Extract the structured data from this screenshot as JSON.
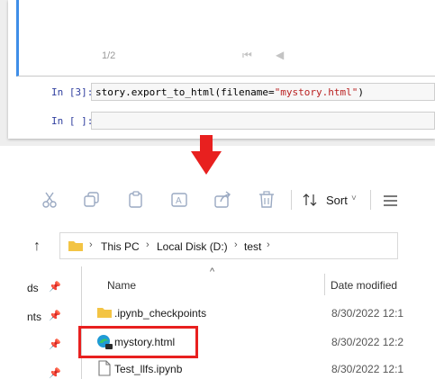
{
  "notebook": {
    "slide_counter": "1/2",
    "first_button": "⏮",
    "prev_button": "◀",
    "cells": [
      {
        "prompt": "In [3]:",
        "code_plain": "story.export_to_html(filename=",
        "code_string": "\"mystory.html\"",
        "code_end": ")"
      },
      {
        "prompt": "In [ ]:",
        "code_plain": "",
        "code_string": "",
        "code_end": ""
      }
    ]
  },
  "arrow": {
    "color": "#e8201f",
    "direction": "down"
  },
  "explorer": {
    "toolbar": {
      "icons": [
        "cut-icon",
        "copy-icon",
        "paste-icon",
        "rename-icon",
        "share-icon",
        "delete-icon"
      ],
      "sort_label": "Sort",
      "sort_chevron": "˅",
      "view_icon": "view-menu-icon"
    },
    "breadcrumb": {
      "up_arrow": "↑",
      "items": [
        "This PC",
        "Local Disk (D:)",
        "test"
      ],
      "separator": "›"
    },
    "columns": {
      "name": "Name",
      "date": "Date modified",
      "sort_indicator": "^"
    },
    "nav_items": [
      {
        "label": "ds"
      },
      {
        "label": "nts"
      },
      {
        "label": ""
      },
      {
        "label": ""
      }
    ],
    "files": [
      {
        "name": ".ipynb_checkpoints",
        "date": "8/30/2022 12:1",
        "icon": "folder-icon"
      },
      {
        "name": "mystory.html",
        "date": "8/30/2022 12:2",
        "icon": "edge-html-icon",
        "highlighted": true
      },
      {
        "name": "Test_llfs.ipynb",
        "date": "8/30/2022 12:1",
        "icon": "document-icon"
      }
    ],
    "highlight_color": "#e8201f"
  }
}
